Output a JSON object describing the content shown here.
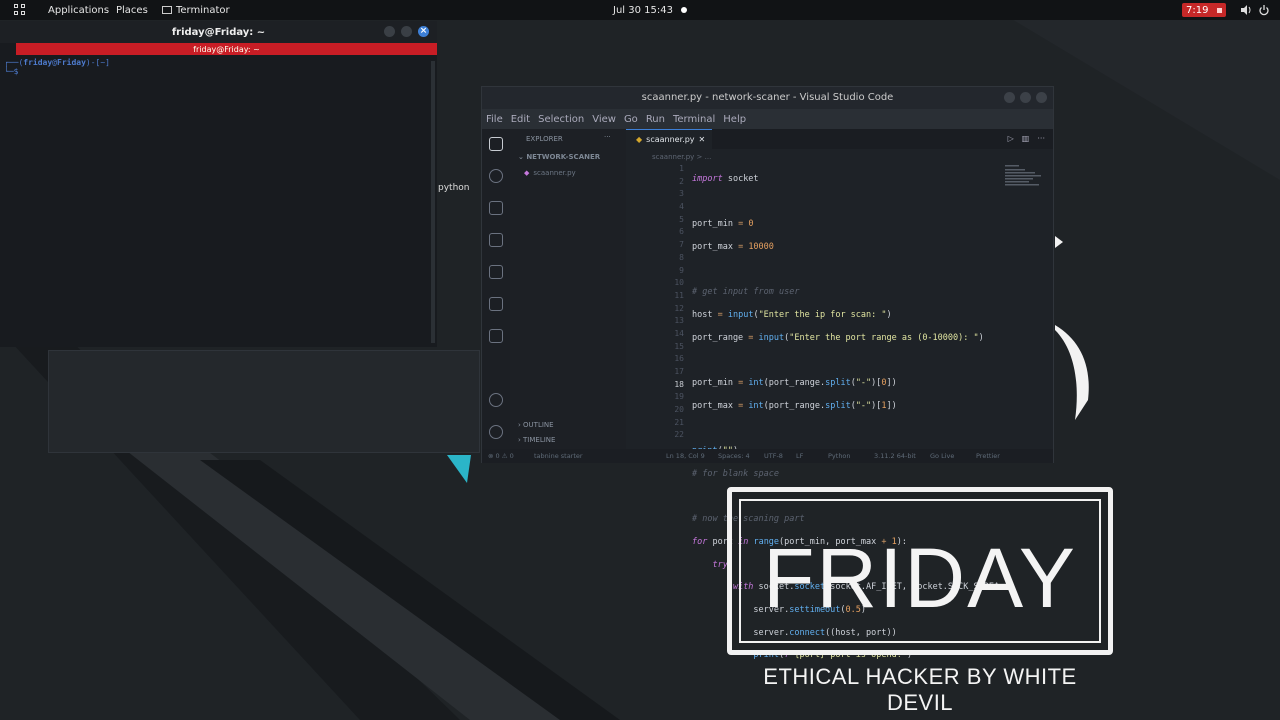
{
  "topbar": {
    "applications": "Applications",
    "places": "Places",
    "app_name": "Terminator",
    "clock": "Jul 30  15:43",
    "recording_time": "7:19"
  },
  "terminal": {
    "window_title": "friday@Friday: ~",
    "tab_title": "friday@Friday: ~",
    "prompt_user": "friday",
    "prompt_at": "@",
    "prompt_host": "Friday",
    "prompt_path": "[~]",
    "prompt_symbol": "$",
    "side_label": "python"
  },
  "vscode": {
    "title": "scaanner.py - network-scaner - Visual Studio Code",
    "menu": [
      "File",
      "Edit",
      "Selection",
      "View",
      "Go",
      "Run",
      "Terminal",
      "Help"
    ],
    "explorer_label": "EXPLORER",
    "explorer_more": "···",
    "folder": "NETWORK-SCANER",
    "file": "scaanner.py",
    "outline": "OUTLINE",
    "timeline": "TIMELINE",
    "active_tab": "scaanner.py",
    "breadcrumb": "scaanner.py > ...",
    "status": {
      "problems": "⊗ 0 ⚠ 0",
      "tabnine": "tabnine starter",
      "position": "Ln 18, Col 9",
      "spaces": "Spaces: 4",
      "encoding": "UTF-8",
      "eol": "LF",
      "language": "Python",
      "interpreter": "3.11.2 64-bit",
      "golive": "Go Live",
      "prettier": "Prettier"
    },
    "line_numbers": [
      "1",
      "2",
      "3",
      "4",
      "5",
      "6",
      "7",
      "8",
      "9",
      "10",
      "11",
      "12",
      "13",
      "14",
      "15",
      "16",
      "17",
      "18",
      "19",
      "20",
      "21",
      "22"
    ]
  },
  "logo": {
    "title": "FRIDAY",
    "subtitle": "ETHICAL HACKER BY WHITE DEVIL"
  },
  "colors": {
    "accent_red": "#c81d25",
    "accent_blue": "#3d7fd6",
    "teal": "#2bb5c8"
  }
}
